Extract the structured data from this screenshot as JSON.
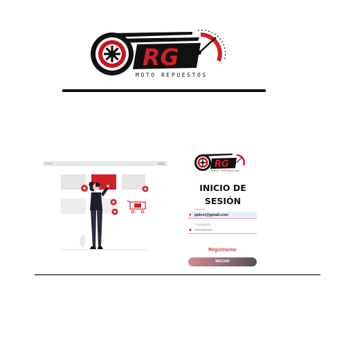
{
  "brand": {
    "initials": "RG",
    "tagline": "MOTO REPUESTOS"
  },
  "login": {
    "title_line1": "INICIO DE",
    "title_line2": "SESIÓN",
    "user_label": "Usuario",
    "user_value": "pptest@gmail.com",
    "password_label": "Contraseña",
    "password_mask": "••••••••••••",
    "register_label": "Registrarme",
    "submit_label": "INICIAR"
  },
  "colors": {
    "accent_red": "#d11f26",
    "dark": "#111111",
    "field_highlight": "#e8eef8"
  },
  "icons": {
    "user_field": "user-icon",
    "password_field": "lock-icon"
  }
}
